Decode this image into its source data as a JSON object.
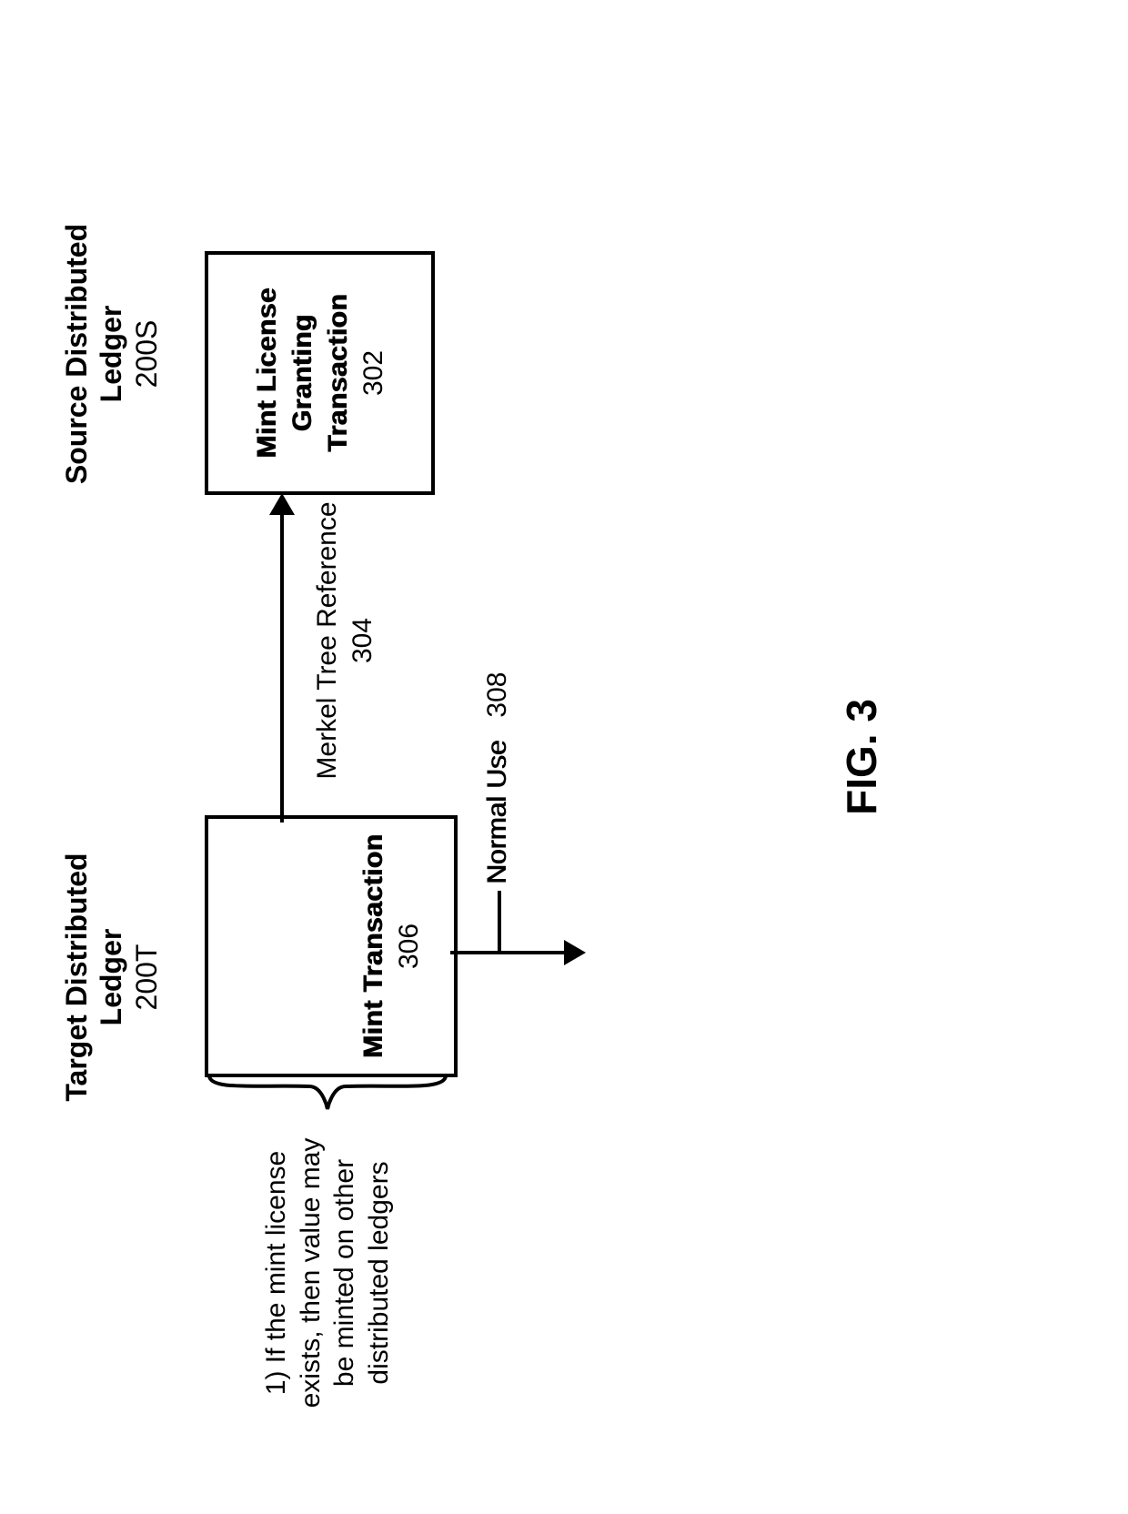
{
  "headers": {
    "target": {
      "title": "Target Distributed Ledger",
      "ref": "200T"
    },
    "source": {
      "title": "Source Distributed Ledger",
      "ref": "200S"
    }
  },
  "mint_transaction": {
    "label": "Mint Transaction",
    "ref": "306"
  },
  "mint_license": {
    "line1": "Mint License",
    "line2": "Granting",
    "line3": "Transaction",
    "ref": "302"
  },
  "merkel_ref": {
    "label": "Merkel Tree Reference",
    "ref": "304"
  },
  "normal_use": {
    "label": "Normal Use",
    "ref": "308"
  },
  "note": "1) If the mint license exists, then value may be minted on other distributed ledgers",
  "figure_label": "FIG. 3"
}
